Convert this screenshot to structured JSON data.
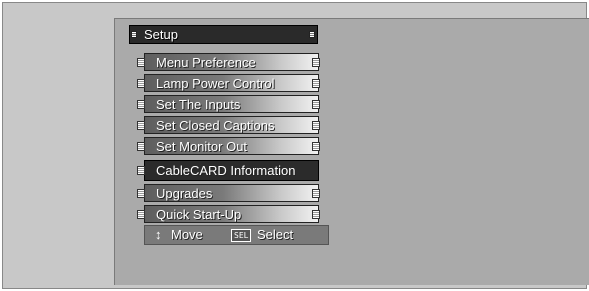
{
  "menu": {
    "title": "Setup",
    "items": [
      {
        "label": "Menu Preference"
      },
      {
        "label": "Lamp Power Control"
      },
      {
        "label": "Set The Inputs"
      },
      {
        "label": "Set Closed Captions"
      },
      {
        "label": "Set Monitor Out"
      },
      {
        "label": "CableCARD Information",
        "selected": true
      },
      {
        "label": "Upgrades"
      },
      {
        "label": "Quick Start-Up"
      }
    ]
  },
  "footer": {
    "move_icon": "arrows-icon",
    "move_label": "Move",
    "sel_key": "SEL",
    "select_label": "Select"
  },
  "colors": {
    "screen_bg": "#d2d2d2",
    "panel_bg": "#b4b4b4",
    "title_bg": "#2a2a2a",
    "selected_bg": "#2b2b2b",
    "text": "#ffffff"
  }
}
